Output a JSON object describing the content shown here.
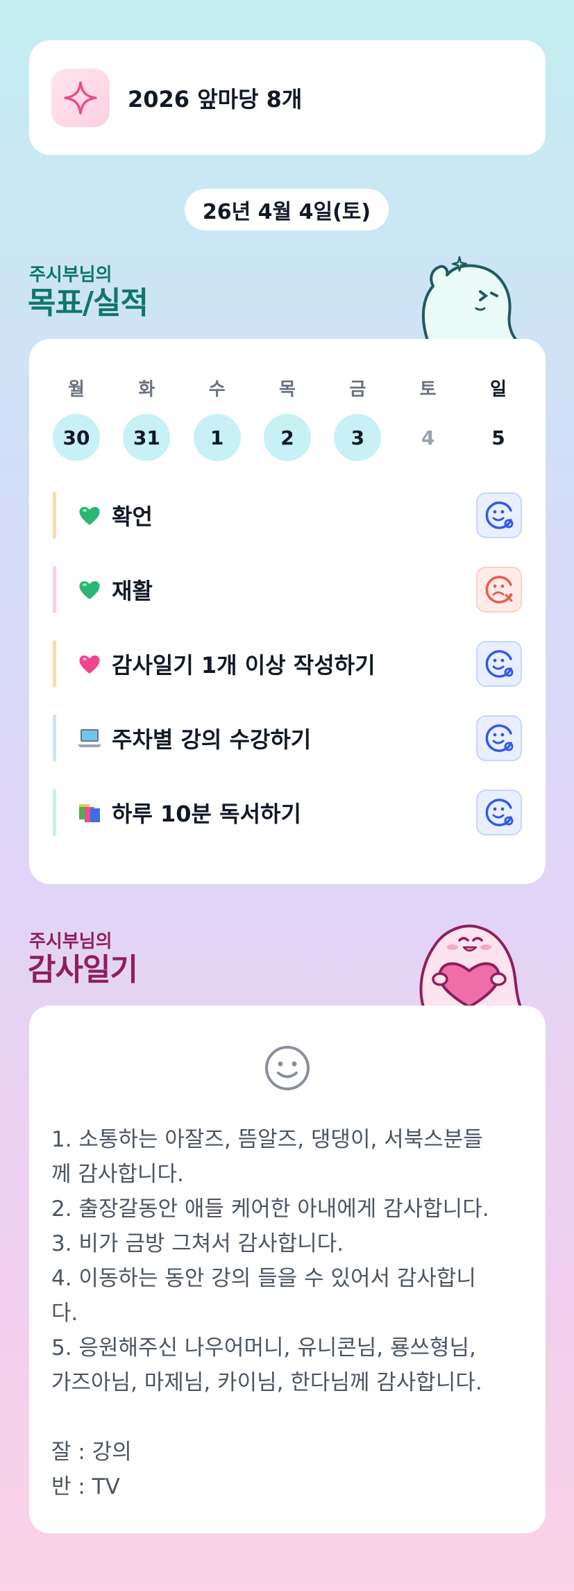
{
  "header": {
    "title": "2026 앞마당 8개",
    "icon": "sparkle-icon",
    "icon_color": "#e94d8a"
  },
  "date_label": "26년 4월 4일(토)",
  "goals_section": {
    "subtitle": "주시부님의",
    "title": "목표/실적",
    "title_color": "#0f766e"
  },
  "calendar": {
    "weekdays": [
      "월",
      "화",
      "수",
      "목",
      "금",
      "토",
      "일"
    ],
    "days": [
      {
        "num": "30",
        "state": "done"
      },
      {
        "num": "31",
        "state": "done"
      },
      {
        "num": "1",
        "state": "done"
      },
      {
        "num": "2",
        "state": "done"
      },
      {
        "num": "3",
        "state": "done"
      },
      {
        "num": "4",
        "state": "inactive"
      },
      {
        "num": "5",
        "state": "plain"
      }
    ],
    "done_color": "#c7f1f4"
  },
  "goals": [
    {
      "label": "확언",
      "emoji": "green-heart-icon",
      "bar_color": "#f7dcae",
      "status": "success"
    },
    {
      "label": "재활",
      "emoji": "green-heart-icon",
      "bar_color": "#f8cfe3",
      "status": "fail"
    },
    {
      "label": "감사일기 1개 이상 작성하기",
      "emoji": "pink-heart-icon",
      "bar_color": "#f7dcae",
      "status": "success"
    },
    {
      "label": "주차별 강의 수강하기",
      "emoji": "laptop-icon",
      "bar_color": "#cfe2f5",
      "status": "success"
    },
    {
      "label": "하루 10분 독서하기",
      "emoji": "books-icon",
      "bar_color": "#c9efe4",
      "status": "success"
    }
  ],
  "status_colors": {
    "success": "#2f5bea",
    "fail": "#ef5a4a"
  },
  "diary_section": {
    "subtitle": "주시부님의",
    "title": "감사일기",
    "title_color": "#8e1f5c"
  },
  "diary": {
    "icon": "smile-icon",
    "text": "1. 소통하는 아잘즈, 뜸알즈, 댕댕이, 서북스분들\n께 감사합니다.\n2. 출장갈동안 애들 케어한 아내에게 감사합니다.\n3. 비가 금방 그쳐서 감사합니다.\n4. 이동하는 동안 강의 들을 수 있어서 감사합니\n다.\n5. 응원해주신 나우어머니, 유니콘님, 룡쓰형님,\n가즈아님, 마제님, 카이님, 한다님께 감사합니다.\n\n잘 : 강의\n반 : TV"
  }
}
